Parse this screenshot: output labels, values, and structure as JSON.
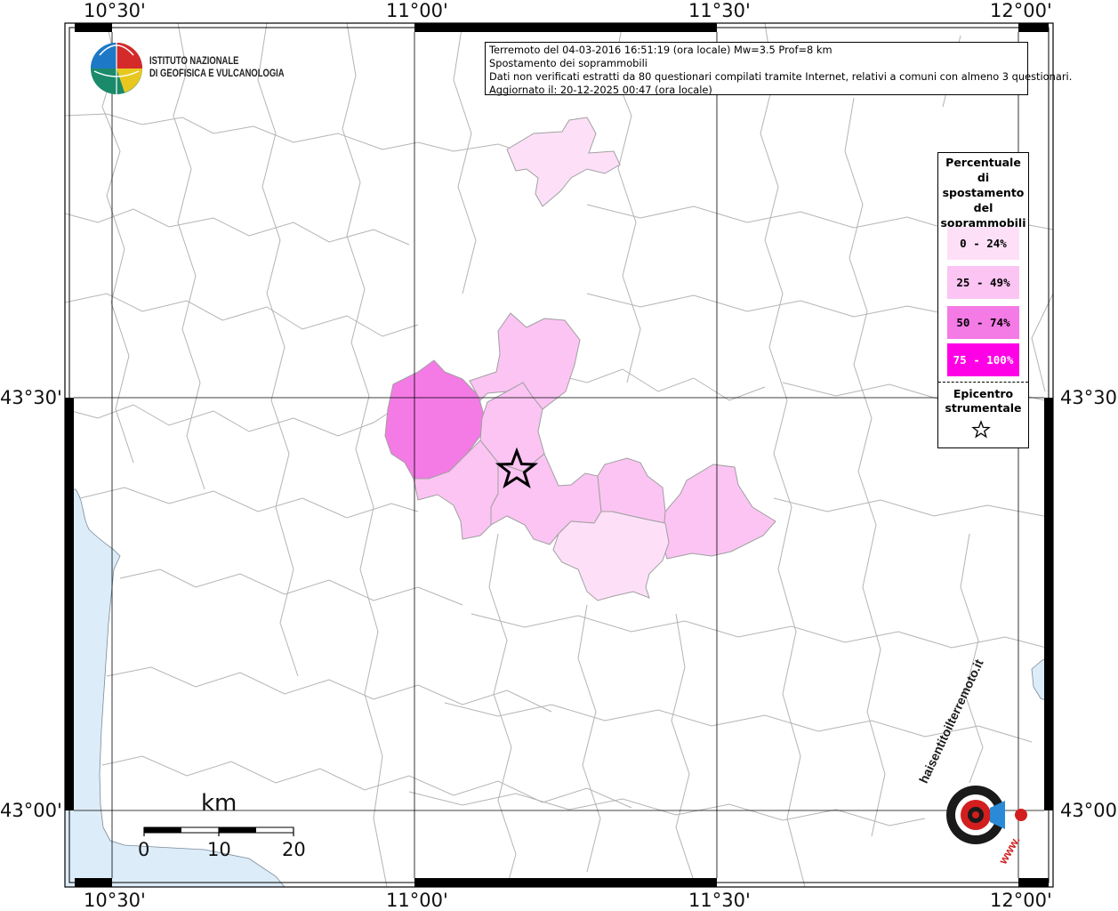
{
  "coordinates": {
    "top": [
      "10°30'",
      "11°00'",
      "11°30'",
      "12°00'"
    ],
    "bottom": [
      "10°30'",
      "11°00'",
      "11°30'",
      "12°00'"
    ],
    "left": [
      "43°30'",
      "43°00'"
    ],
    "right": [
      "43°30'",
      "43°00'"
    ]
  },
  "logo": {
    "line1": "ISTITUTO NAZIONALE",
    "line2": "DI GEOFISICA E VULCANOLOGIA"
  },
  "info": {
    "line1": "Terremoto del 04-03-2016 16:51:19 (ora locale) Mw=3.5 Prof=8 km",
    "line2": "Spostamento dei soprammobili",
    "line3": "Dati non verificati estratti da 80 questionari compilati tramite Internet, relativi a comuni con almeno 3 questionari.",
    "line4": "Aggiornato il: 20-12-2025 00:47 (ora locale)"
  },
  "legend": {
    "title_lines": [
      "Percentuale",
      "di",
      "spostamento",
      "del",
      "soprammobili"
    ],
    "classes": [
      {
        "label": "0 - 24%",
        "color": "#fde0f8"
      },
      {
        "label": "25 - 49%",
        "color": "#fbc4f3"
      },
      {
        "label": "50 - 74%",
        "color": "#f47ae6"
      },
      {
        "label": "75 - 100%",
        "color": "#ff00e6"
      }
    ],
    "epicenter_lines": [
      "Epicentro",
      "strumentale"
    ]
  },
  "scale": {
    "unit": "km",
    "ticks": [
      "0",
      "10",
      "20"
    ]
  },
  "hsit_logo": {
    "text": "haisentitoilterremoto.it",
    "sub": "www."
  },
  "colors": {
    "sea": "#dcecf8",
    "border": "#aaaaaa",
    "grid": "#000000"
  }
}
